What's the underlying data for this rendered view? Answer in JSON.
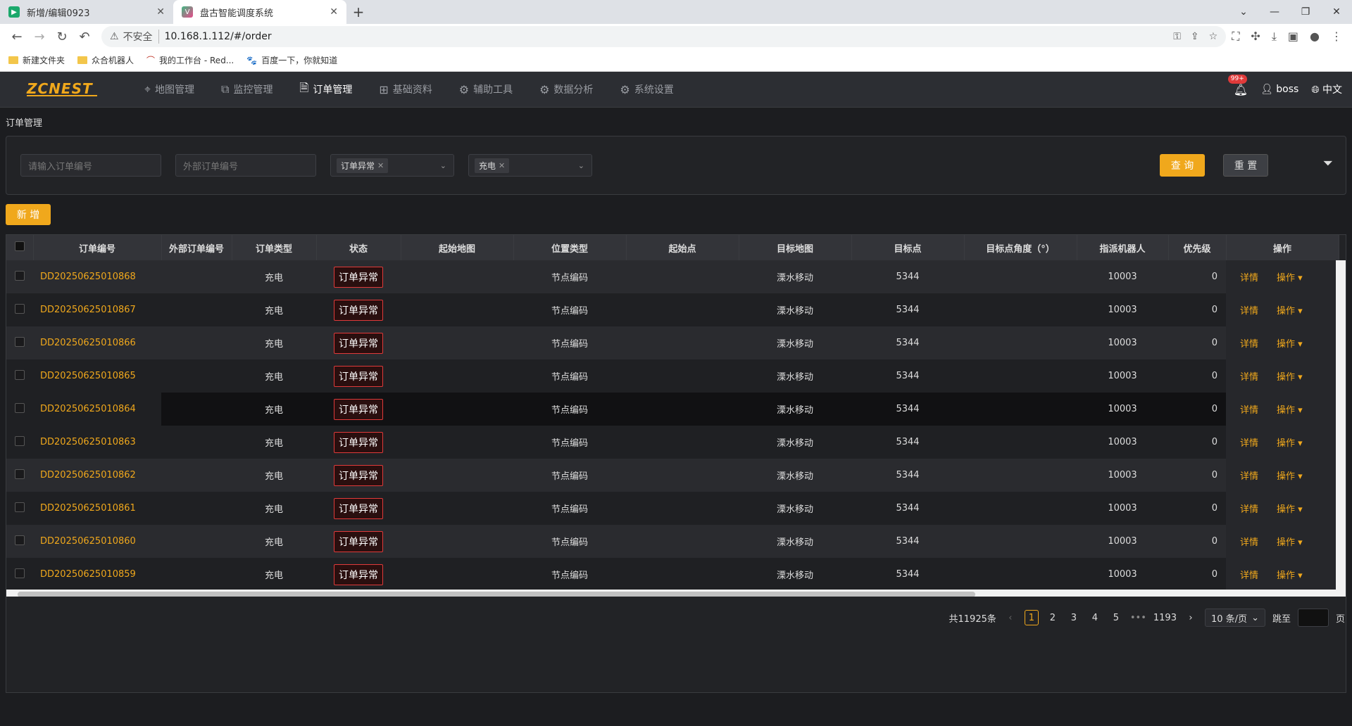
{
  "browser": {
    "tabs": [
      {
        "title": "新增/编辑0923",
        "active": false
      },
      {
        "title": "盘古智能调度系统",
        "active": true
      }
    ],
    "address": {
      "insecure_label": "不安全",
      "url": "10.168.1.112/#/order"
    },
    "bookmarks": [
      {
        "label": "新建文件夹"
      },
      {
        "label": "众合机器人"
      },
      {
        "label": "我的工作台 - Red..."
      },
      {
        "label": "百度一下，你就知道"
      }
    ]
  },
  "app": {
    "logo": "ZCNEST",
    "menu": [
      {
        "label": "地图管理",
        "icon": "map-pin-icon"
      },
      {
        "label": "监控管理",
        "icon": "chart-icon"
      },
      {
        "label": "订单管理",
        "icon": "document-icon",
        "active": true
      },
      {
        "label": "基础资料",
        "icon": "sliders-icon"
      },
      {
        "label": "辅助工具",
        "icon": "gear-icon"
      },
      {
        "label": "数据分析",
        "icon": "gear-icon"
      },
      {
        "label": "系统设置",
        "icon": "gear-icon"
      }
    ],
    "badge": "99+",
    "user": "boss",
    "language": "中文"
  },
  "breadcrumb": "订单管理",
  "filters": {
    "order_no_placeholder": "请输入订单编号",
    "external_no_placeholder": "外部订单编号",
    "status_tag": "订单异常",
    "type_tag": "充电",
    "query_label": "查 询",
    "reset_label": "重 置"
  },
  "add_label": "新 增",
  "table": {
    "columns": [
      "订单编号",
      "外部订单编号",
      "订单类型",
      "状态",
      "起始地图",
      "位置类型",
      "起始点",
      "目标地图",
      "目标点",
      "目标点角度（°）",
      "指派机器人",
      "优先级",
      "操作"
    ],
    "detail_label": "详情",
    "op_label": "操作",
    "rows": [
      {
        "id": "DD20250625010868",
        "ext": "",
        "type": "充电",
        "status": "订单异常",
        "start_map": "",
        "pos_type": "节点编码",
        "start": "",
        "target_map": "溧水移动",
        "target": "5344",
        "angle": "",
        "robot": "10003",
        "priority": "0"
      },
      {
        "id": "DD20250625010867",
        "ext": "",
        "type": "充电",
        "status": "订单异常",
        "start_map": "",
        "pos_type": "节点编码",
        "start": "",
        "target_map": "溧水移动",
        "target": "5344",
        "angle": "",
        "robot": "10003",
        "priority": "0"
      },
      {
        "id": "DD20250625010866",
        "ext": "",
        "type": "充电",
        "status": "订单异常",
        "start_map": "",
        "pos_type": "节点编码",
        "start": "",
        "target_map": "溧水移动",
        "target": "5344",
        "angle": "",
        "robot": "10003",
        "priority": "0"
      },
      {
        "id": "DD20250625010865",
        "ext": "",
        "type": "充电",
        "status": "订单异常",
        "start_map": "",
        "pos_type": "节点编码",
        "start": "",
        "target_map": "溧水移动",
        "target": "5344",
        "angle": "",
        "robot": "10003",
        "priority": "0"
      },
      {
        "id": "DD20250625010864",
        "ext": "",
        "type": "充电",
        "status": "订单异常",
        "start_map": "",
        "pos_type": "节点编码",
        "start": "",
        "target_map": "溧水移动",
        "target": "5344",
        "angle": "",
        "robot": "10003",
        "priority": "0"
      },
      {
        "id": "DD20250625010863",
        "ext": "",
        "type": "充电",
        "status": "订单异常",
        "start_map": "",
        "pos_type": "节点编码",
        "start": "",
        "target_map": "溧水移动",
        "target": "5344",
        "angle": "",
        "robot": "10003",
        "priority": "0"
      },
      {
        "id": "DD20250625010862",
        "ext": "",
        "type": "充电",
        "status": "订单异常",
        "start_map": "",
        "pos_type": "节点编码",
        "start": "",
        "target_map": "溧水移动",
        "target": "5344",
        "angle": "",
        "robot": "10003",
        "priority": "0"
      },
      {
        "id": "DD20250625010861",
        "ext": "",
        "type": "充电",
        "status": "订单异常",
        "start_map": "",
        "pos_type": "节点编码",
        "start": "",
        "target_map": "溧水移动",
        "target": "5344",
        "angle": "",
        "robot": "10003",
        "priority": "0"
      },
      {
        "id": "DD20250625010860",
        "ext": "",
        "type": "充电",
        "status": "订单异常",
        "start_map": "",
        "pos_type": "节点编码",
        "start": "",
        "target_map": "溧水移动",
        "target": "5344",
        "angle": "",
        "robot": "10003",
        "priority": "0"
      },
      {
        "id": "DD20250625010859",
        "ext": "",
        "type": "充电",
        "status": "订单异常",
        "start_map": "",
        "pos_type": "节点编码",
        "start": "",
        "target_map": "溧水移动",
        "target": "5344",
        "angle": "",
        "robot": "10003",
        "priority": "0"
      }
    ]
  },
  "pagination": {
    "total": "共11925条",
    "pages": [
      "1",
      "2",
      "3",
      "4",
      "5"
    ],
    "ellipsis": "•••",
    "last": "1193",
    "page_size": "10 条/页",
    "jump_label": "跳至",
    "page_unit": "页"
  },
  "colors": {
    "accent": "#f0a81c",
    "danger": "#e03a3a",
    "bg": "#1c1d20"
  }
}
